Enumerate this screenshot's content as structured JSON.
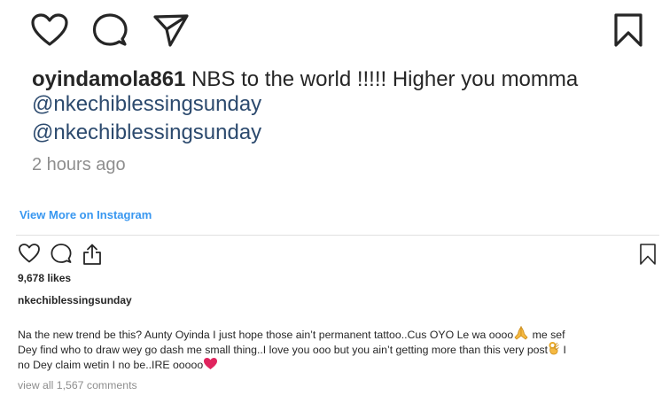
{
  "top": {
    "username": "oyindamola861",
    "caption_text": "NBS to the world !!!!! Higher you momma",
    "mention_1": "@nkechiblessingsunday",
    "mention_2": "@nkechiblessingsunday",
    "timestamp": "2 hours ago"
  },
  "embed": {
    "view_more_link": "View More on Instagram",
    "likes": "9,678 likes",
    "owner_username": "nkechiblessingsunday",
    "comment_line_1": "Na the new trend be this? Aunty Oyinda I just hope those ain’t permanent tattoo..Cus OYO Le wa oooo",
    "comment_line_1_end": " me sef",
    "comment_line_2": "Dey find who to draw wey go dash me small thing..I love you ooo but you ain’t getting more than this very post",
    "comment_line_2_end": " I",
    "comment_line_3": "no Dey claim wetin I no be..IRE ooooo",
    "view_all_comments": "view all 1,567 comments"
  },
  "icons": {
    "top": [
      "heart-icon",
      "comment-icon",
      "share-icon",
      "bookmark-icon"
    ],
    "small": [
      "heart-icon",
      "comment-icon",
      "share-icon",
      "bookmark-icon"
    ],
    "emoji": [
      "praying-hands-emoji",
      "ok-hand-emoji",
      "red-heart-emoji"
    ]
  },
  "colors": {
    "link": "#3897f0",
    "mention": "#2c4a6e",
    "muted": "#8e8e8e",
    "heart_emoji": "#e0245e"
  }
}
